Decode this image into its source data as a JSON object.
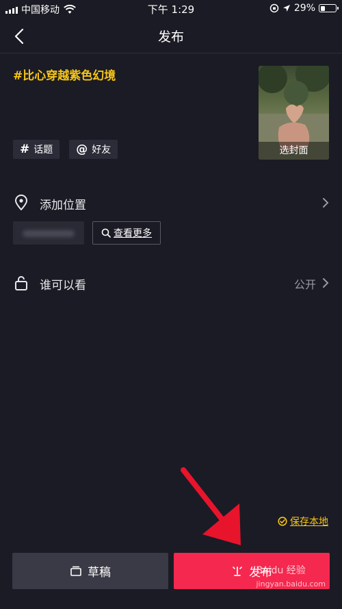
{
  "status_bar": {
    "carrier": "中国移动",
    "time": "下午 1:29",
    "battery": "29%",
    "battery_level": 0.29
  },
  "nav": {
    "title": "发布"
  },
  "post": {
    "topic": "#比心穿越紫色幻境",
    "cover_label": "选封面",
    "topic_chip": "话题",
    "friend_chip": "好友"
  },
  "location": {
    "label": "添加位置",
    "see_more": "查看更多"
  },
  "privacy": {
    "label": "谁可以看",
    "value": "公开"
  },
  "actions": {
    "save_local": "保存本地",
    "draft": "草稿",
    "publish": "发布"
  },
  "watermark": {
    "brand": "Baidu 经验",
    "url": "jingyan.baidu.com"
  },
  "colors": {
    "background": "#1b1b25",
    "accent_yellow": "#f5c518",
    "publish_red": "#f5284f",
    "annotation_arrow": "#e8142c"
  }
}
